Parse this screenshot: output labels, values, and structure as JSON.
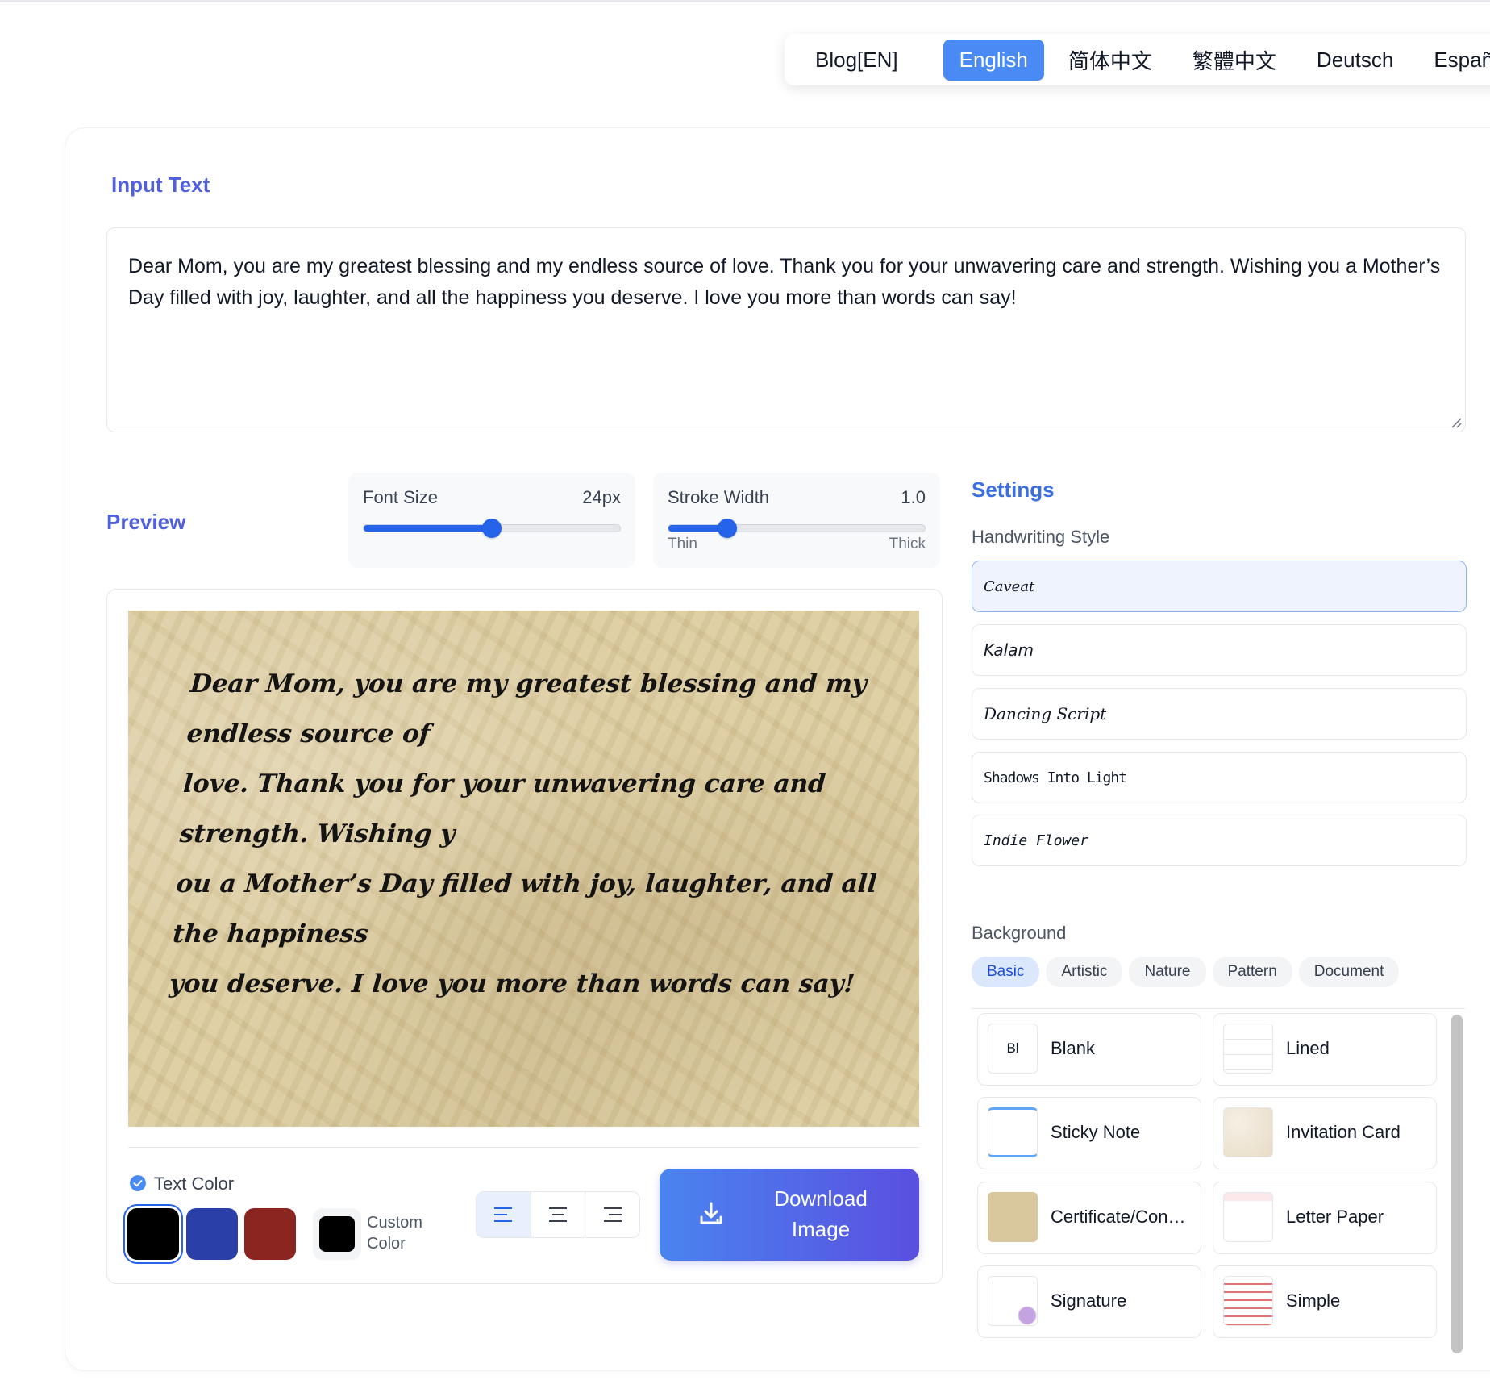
{
  "nav": {
    "items": [
      {
        "label": "Blog[EN]",
        "active": false
      },
      {
        "label": "English",
        "active": true
      },
      {
        "label": "简体中文",
        "active": false
      },
      {
        "label": "繁體中文",
        "active": false
      },
      {
        "label": "Deutsch",
        "active": false
      },
      {
        "label": "Español",
        "active": false
      }
    ]
  },
  "input": {
    "title": "Input Text",
    "value": "Dear Mom, you are my greatest blessing and my endless source of love. Thank you for your unwavering care and strength. Wishing you a Mother’s Day filled with joy, laughter, and all the happiness you deserve. I love you more than words can say!"
  },
  "preview": {
    "title": "Preview",
    "lines": [
      "Dear Mom, you are my greatest blessing and my endless source of",
      "love. Thank you for your unwavering care and strength. Wishing y",
      "ou a Mother’s Day filled with joy, laughter, and all the happiness",
      "you deserve. I love you more than words can say!"
    ]
  },
  "font_size": {
    "label": "Font Size",
    "value_text": "24px",
    "fraction": 0.5
  },
  "stroke_width": {
    "label": "Stroke Width",
    "value_text": "1.0",
    "min_label": "Thin",
    "max_label": "Thick",
    "fraction": 0.23
  },
  "text_color": {
    "label": "Text Color",
    "swatches": [
      "#000000",
      "#2a40a8",
      "#8b2520"
    ],
    "selected": "#000000",
    "custom_label_1": "Custom",
    "custom_label_2": "Color",
    "custom_value": "#000000"
  },
  "alignment": {
    "options": [
      "align-left",
      "align-center",
      "align-right"
    ],
    "active": "align-left"
  },
  "download": {
    "label_1": "Download",
    "label_2": "Image"
  },
  "settings": {
    "title": "Settings",
    "handwriting_label": "Handwriting Style",
    "styles": [
      "Caveat",
      "Kalam",
      "Dancing Script",
      "Shadows Into Light",
      "Indie Flower"
    ],
    "selected_style": "Caveat",
    "background_label": "Background",
    "bg_tabs": [
      "Basic",
      "Artistic",
      "Nature",
      "Pattern",
      "Document"
    ],
    "active_bg_tab": "Basic",
    "backgrounds": [
      {
        "name": "Blank",
        "abbr": "Bl"
      },
      {
        "name": "Lined",
        "abbr": ""
      },
      {
        "name": "Sticky Note",
        "abbr": ""
      },
      {
        "name": "Invitation Card",
        "abbr": ""
      },
      {
        "name": "Certificate/Con…",
        "abbr": ""
      },
      {
        "name": "Letter Paper",
        "abbr": ""
      },
      {
        "name": "Signature",
        "abbr": ""
      },
      {
        "name": "Simple",
        "abbr": ""
      }
    ]
  },
  "colors": {
    "accent": "#4a8af4",
    "title": "#4f5fe0",
    "paper": "#dccb9e"
  }
}
